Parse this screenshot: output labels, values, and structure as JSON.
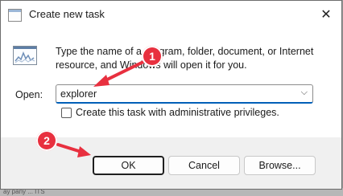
{
  "background": {
    "partial_text": "ay   pany   ...   ITS"
  },
  "dialog": {
    "title": "Create new task",
    "close_glyph": "✕",
    "instructions": "Type the name of a program, folder, document, or Internet resource, and Windows will open it for you.",
    "open_label": "Open:",
    "open_value": "explorer",
    "dropdown_glyph": "⌵",
    "admin_checkbox_label": "Create this task with administrative privileges.",
    "admin_checked": false
  },
  "buttons": {
    "ok": "OK",
    "cancel": "Cancel",
    "browse": "Browse..."
  },
  "annotations": {
    "badge1": "1",
    "badge2": "2",
    "color": "#e8303f"
  }
}
